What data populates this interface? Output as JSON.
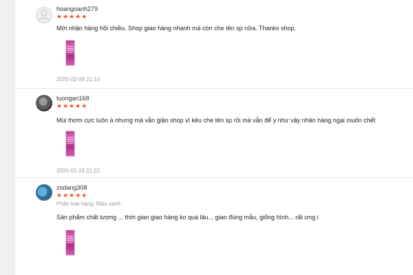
{
  "reviews": [
    {
      "username": "hoangoanh279",
      "stars": "★★★★★",
      "comment": "Mới nhận hàng hồi chiều. Shop giao hàng nhanh mà còn che tên sp nữa. Thanks shop.",
      "timestamp": "2020-02-08 21:10",
      "avatar_icon": "default-user-icon"
    },
    {
      "username": "tuongan168",
      "stars": "★★★★★",
      "comment": "Mùi thơm cực luôn à nhưng mà vẫn giận shop vì kêu che tên sp rồi mà vẫn để y như vậy nhân hàng ngại muốn chết",
      "timestamp": "2020-01-19 21:22",
      "avatar_icon": "user-photo-avatar"
    },
    {
      "username": "zodang308",
      "stars": "★★★★★",
      "variation": "Phân loại hàng: Màu xanh",
      "comment": "Sản phẩm chất lượng ... thời gian giao hàng ko quá lâu... giao đúng mẫu, giống hình... rất ưng i",
      "avatar_icon": "user-photo-avatar"
    }
  ],
  "colors": {
    "star": "#ee4d2d"
  }
}
